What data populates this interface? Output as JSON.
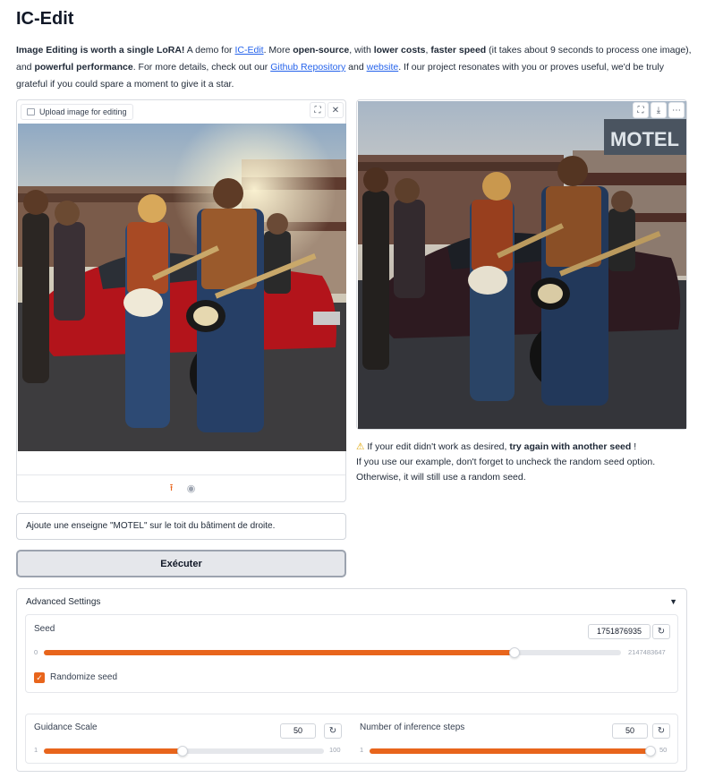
{
  "app": {
    "title": "IC-Edit",
    "description": {
      "p1_bold": "Image Editing is worth a single LoRA!",
      "p2": " A demo for ",
      "link_icedit": "IC-Edit",
      "p3": ". More ",
      "b_open": "open-source",
      "p4": ", with ",
      "b_costs": "lower costs",
      "p5": ", ",
      "b_speed": "faster speed",
      "p6": " (it takes about 9 seconds to process one image), and ",
      "b_perf": "powerful performance",
      "p7": ". For more details, check out our ",
      "link_github": "Github Repository",
      "p8": " and ",
      "link_website": "website",
      "p9": ". If our project resonates with you or proves useful, we'd be truly grateful if you could spare a moment to give it a star."
    }
  },
  "input_panel": {
    "upload_label": "Upload image for editing",
    "icons": [
      "fullscreen-icon",
      "close-icon",
      "upload-icon",
      "webcam-icon"
    ]
  },
  "output_panel": {
    "icons": [
      "fullscreen-icon",
      "download-icon",
      "share-icon"
    ],
    "sign_text": "MOTEL"
  },
  "note": {
    "warn_icon": "warning-icon",
    "t1": " If your edit didn't work as desired, ",
    "t1_bold": "try again with another seed",
    "t2": " !",
    "t3": "If you use our example, don't forget to uncheck the random seed option. Otherwise, it will still use a random seed."
  },
  "prompt": {
    "value": "Ajoute une enseigne \"MOTEL\" sur le toit du bâtiment de droite."
  },
  "run_button": {
    "label": "Exécuter"
  },
  "advanced": {
    "header": "Advanced Settings",
    "caret": "▼",
    "seed": {
      "label": "Seed",
      "value": "1751876935",
      "min": "0",
      "max": "2147483647",
      "fraction": 0.8155
    },
    "randomize": {
      "label": "Randomize seed",
      "checked": true
    },
    "guidance": {
      "label": "Guidance Scale",
      "value": "50",
      "min": "1",
      "max": "100",
      "fraction": 0.495
    },
    "steps": {
      "label": "Number of inference steps",
      "value": "50",
      "min": "1",
      "max": "50",
      "fraction": 1.0
    }
  },
  "colors": {
    "accent": "#e8651c",
    "link": "#2563eb",
    "border": "#d9dce1"
  }
}
